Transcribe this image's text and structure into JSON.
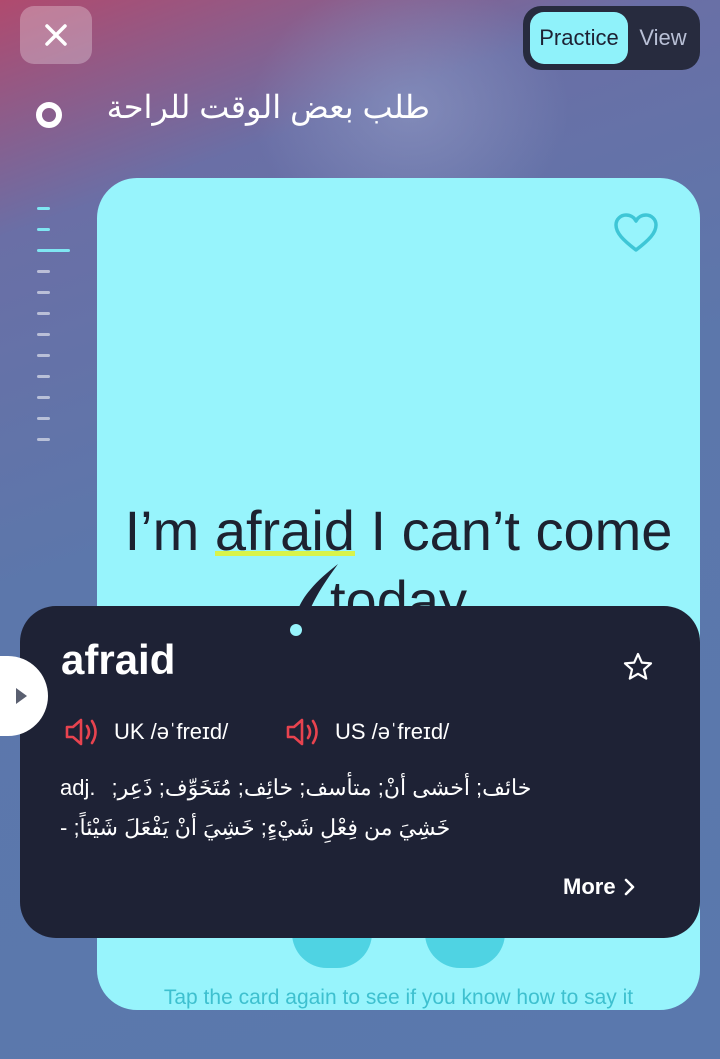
{
  "header": {
    "mode_options": [
      "Practice",
      "View"
    ],
    "selected_mode": "Practice",
    "lesson_title": "طلب بعض الوقت للراحة"
  },
  "progress": {
    "total_steps": 12,
    "current_step": 3
  },
  "card": {
    "sentence_before": "I’m ",
    "sentence_highlight": "afraid",
    "sentence_after": " I can’t come today",
    "hint": "Tap the card again to see if you know how to say it",
    "accent_color": "#97f4fc"
  },
  "dictionary": {
    "word": "afraid",
    "uk_label": "UK /əˈfreɪd/",
    "us_label": "US /əˈfreɪd/",
    "part_of_speech": "adj.",
    "definition_line1": "خائف; أخشى أنْ; متأسف; خائِف; مُتَخَوِّف; ذَعِر;",
    "definition_line2": "خَشِيَ من فِعْلِ شَيْءٍ; خَشِيَ أنْ يَفْعَلَ شَيْئاً;    -",
    "more_label": "More",
    "speaker_color": "#e8434f"
  }
}
